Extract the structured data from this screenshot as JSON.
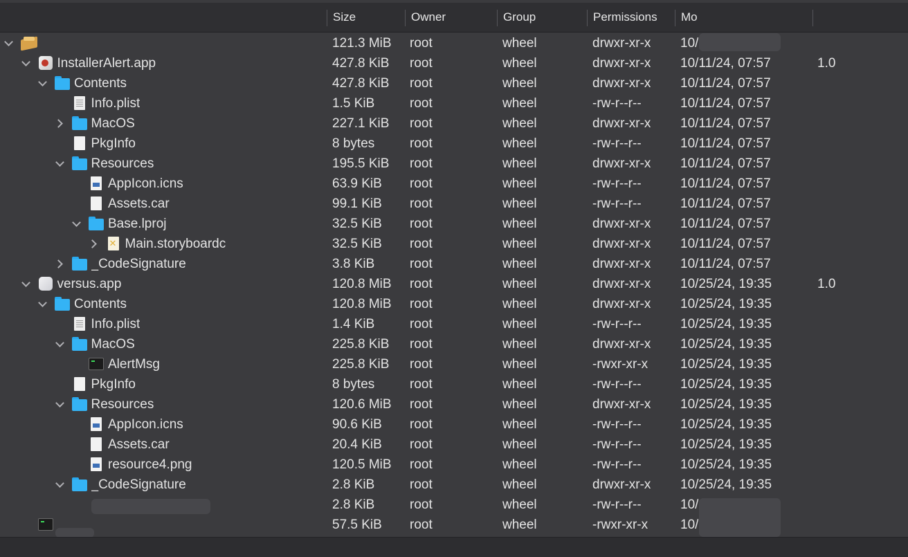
{
  "header": {
    "size": "Size",
    "owner": "Owner",
    "group": "Group",
    "permissions": "Permissions",
    "modified": "Mo"
  },
  "rows": [
    {
      "name": "",
      "icon": "package-icon",
      "size": "121.3 MiB",
      "owner": "root",
      "group": "wheel",
      "perm": "drwxr-xr-x",
      "date": "10/",
      "ver": ""
    },
    {
      "name": "InstallerAlert.app",
      "icon": "app-icon",
      "size": "427.8 KiB",
      "owner": "root",
      "group": "wheel",
      "perm": "drwxr-xr-x",
      "date": "10/11/24, 07:57",
      "ver": "1.0"
    },
    {
      "name": "Contents",
      "icon": "folder-icon",
      "size": "427.8 KiB",
      "owner": "root",
      "group": "wheel",
      "perm": "drwxr-xr-x",
      "date": "10/11/24, 07:57",
      "ver": ""
    },
    {
      "name": "Info.plist",
      "icon": "plist-icon",
      "size": "1.5 KiB",
      "owner": "root",
      "group": "wheel",
      "perm": "-rw-r--r--",
      "date": "10/11/24, 07:57",
      "ver": ""
    },
    {
      "name": "MacOS",
      "icon": "folder-icon",
      "size": "227.1 KiB",
      "owner": "root",
      "group": "wheel",
      "perm": "drwxr-xr-x",
      "date": "10/11/24, 07:57",
      "ver": ""
    },
    {
      "name": "PkgInfo",
      "icon": "document-icon",
      "size": "8 bytes",
      "owner": "root",
      "group": "wheel",
      "perm": "-rw-r--r--",
      "date": "10/11/24, 07:57",
      "ver": ""
    },
    {
      "name": "Resources",
      "icon": "folder-icon",
      "size": "195.5 KiB",
      "owner": "root",
      "group": "wheel",
      "perm": "drwxr-xr-x",
      "date": "10/11/24, 07:57",
      "ver": ""
    },
    {
      "name": "AppIcon.icns",
      "icon": "image-icon",
      "size": "63.9 KiB",
      "owner": "root",
      "group": "wheel",
      "perm": "-rw-r--r--",
      "date": "10/11/24, 07:57",
      "ver": ""
    },
    {
      "name": "Assets.car",
      "icon": "document-icon",
      "size": "99.1 KiB",
      "owner": "root",
      "group": "wheel",
      "perm": "-rw-r--r--",
      "date": "10/11/24, 07:57",
      "ver": ""
    },
    {
      "name": "Base.lproj",
      "icon": "folder-icon",
      "size": "32.5 KiB",
      "owner": "root",
      "group": "wheel",
      "perm": "drwxr-xr-x",
      "date": "10/11/24, 07:57",
      "ver": ""
    },
    {
      "name": "Main.storyboardc",
      "icon": "storyboard-icon",
      "size": "32.5 KiB",
      "owner": "root",
      "group": "wheel",
      "perm": "drwxr-xr-x",
      "date": "10/11/24, 07:57",
      "ver": ""
    },
    {
      "name": "_CodeSignature",
      "icon": "folder-icon",
      "size": "3.8 KiB",
      "owner": "root",
      "group": "wheel",
      "perm": "drwxr-xr-x",
      "date": "10/11/24, 07:57",
      "ver": ""
    },
    {
      "name": "versus.app",
      "icon": "app-icon",
      "size": "120.8 MiB",
      "owner": "root",
      "group": "wheel",
      "perm": "drwxr-xr-x",
      "date": "10/25/24, 19:35",
      "ver": "1.0"
    },
    {
      "name": "Contents",
      "icon": "folder-icon",
      "size": "120.8 MiB",
      "owner": "root",
      "group": "wheel",
      "perm": "drwxr-xr-x",
      "date": "10/25/24, 19:35",
      "ver": ""
    },
    {
      "name": "Info.plist",
      "icon": "plist-icon",
      "size": "1.4 KiB",
      "owner": "root",
      "group": "wheel",
      "perm": "-rw-r--r--",
      "date": "10/25/24, 19:35",
      "ver": ""
    },
    {
      "name": "MacOS",
      "icon": "folder-icon",
      "size": "225.8 KiB",
      "owner": "root",
      "group": "wheel",
      "perm": "drwxr-xr-x",
      "date": "10/25/24, 19:35",
      "ver": ""
    },
    {
      "name": "AlertMsg",
      "icon": "executable-icon",
      "size": "225.8 KiB",
      "owner": "root",
      "group": "wheel",
      "perm": "-rwxr-xr-x",
      "date": "10/25/24, 19:35",
      "ver": ""
    },
    {
      "name": "PkgInfo",
      "icon": "document-icon",
      "size": "8 bytes",
      "owner": "root",
      "group": "wheel",
      "perm": "-rw-r--r--",
      "date": "10/25/24, 19:35",
      "ver": ""
    },
    {
      "name": "Resources",
      "icon": "folder-icon",
      "size": "120.6 MiB",
      "owner": "root",
      "group": "wheel",
      "perm": "drwxr-xr-x",
      "date": "10/25/24, 19:35",
      "ver": ""
    },
    {
      "name": "AppIcon.icns",
      "icon": "image-icon",
      "size": "90.6 KiB",
      "owner": "root",
      "group": "wheel",
      "perm": "-rw-r--r--",
      "date": "10/25/24, 19:35",
      "ver": ""
    },
    {
      "name": "Assets.car",
      "icon": "document-icon",
      "size": "20.4 KiB",
      "owner": "root",
      "group": "wheel",
      "perm": "-rw-r--r--",
      "date": "10/25/24, 19:35",
      "ver": ""
    },
    {
      "name": "resource4.png",
      "icon": "image-icon",
      "size": "120.5 MiB",
      "owner": "root",
      "group": "wheel",
      "perm": "-rw-r--r--",
      "date": "10/25/24, 19:35",
      "ver": ""
    },
    {
      "name": "_CodeSignature",
      "icon": "folder-icon",
      "size": "2.8 KiB",
      "owner": "root",
      "group": "wheel",
      "perm": "drwxr-xr-x",
      "date": "10/25/24, 19:35",
      "ver": ""
    },
    {
      "name": "",
      "icon": "",
      "size": "2.8 KiB",
      "owner": "root",
      "group": "wheel",
      "perm": "-rw-r--r--",
      "date": "10/",
      "ver": ""
    },
    {
      "name": "",
      "icon": "executable-icon",
      "size": "57.5 KiB",
      "owner": "root",
      "group": "wheel",
      "perm": "-rwxr-xr-x",
      "date": "10/",
      "ver": ""
    }
  ]
}
